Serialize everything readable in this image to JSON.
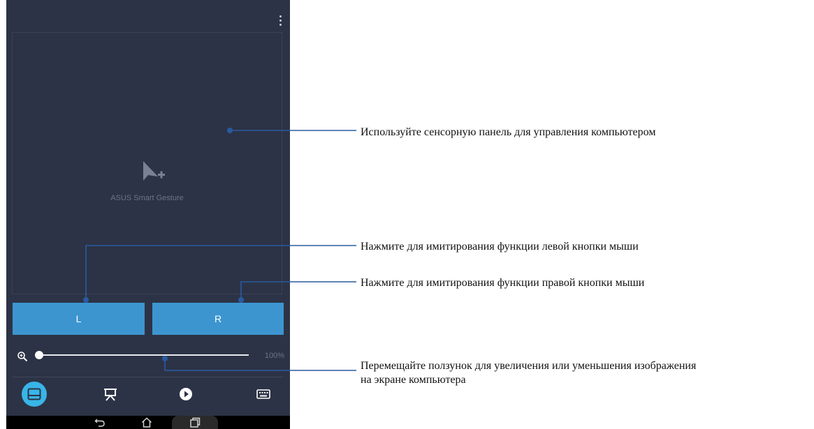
{
  "app": {
    "touchpad_label": "ASUS Smart Gesture",
    "left_button_label": "L",
    "right_button_label": "R",
    "zoom_value": "100%",
    "zoom_level_fraction": 0.0
  },
  "tabs": [
    {
      "name": "touchpad",
      "icon": "touchpad-icon",
      "active": true
    },
    {
      "name": "presentation",
      "icon": "presentation-icon",
      "active": false
    },
    {
      "name": "media",
      "icon": "play-icon",
      "active": false
    },
    {
      "name": "keyboard",
      "icon": "keyboard-icon",
      "active": false
    }
  ],
  "navbar": {
    "icons": [
      "back-icon",
      "home-icon",
      "recent-apps-icon"
    ]
  },
  "annotations": {
    "touchpad": "Используйте сенсорную панель для управления компьютером",
    "left_button": "Нажмите для имитирования функции левой кнопки мыши",
    "right_button": "Нажмите для имитирования функции правой кнопки мыши",
    "zoom_line1": "Перемещайте ползунок для увеличения или уменьшения изображения",
    "zoom_line2": "на экране компьютера"
  },
  "colors": {
    "background": "#2c3346",
    "button": "#3d95d0",
    "active_tab": "#38b5e8",
    "callout_line": "#2a5aa0"
  }
}
